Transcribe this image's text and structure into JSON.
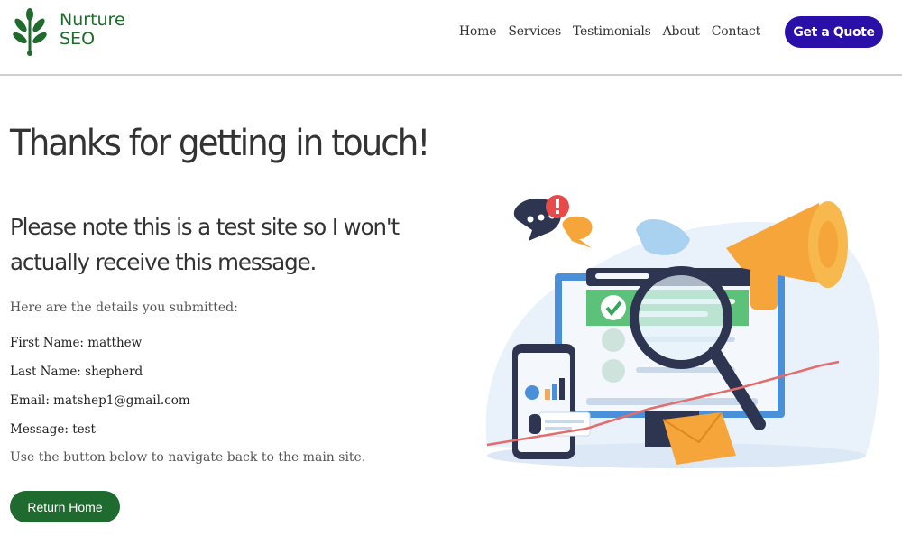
{
  "brand": {
    "line1": "Nurture",
    "line2": "SEO",
    "color": "#1e6b2c"
  },
  "nav": [
    "Home",
    "Services",
    "Testimonials",
    "About",
    "Contact"
  ],
  "quote_button": "Get a Quote",
  "heading": "Thanks for getting in touch!",
  "subheading": "Please note this is a test site so I won't actually receive this message.",
  "intro": "Here are the details you submitted:",
  "fields": [
    "First Name: matthew",
    "Last Name: shepherd",
    "Email: matshep1@gmail.com",
    "Message: test"
  ],
  "navigate_note": "Use the button below to navigate back to the main site.",
  "return_button": "Return Home",
  "colors": {
    "accent_purple": "#2a0fa8",
    "accent_green": "#1f6b2f"
  }
}
